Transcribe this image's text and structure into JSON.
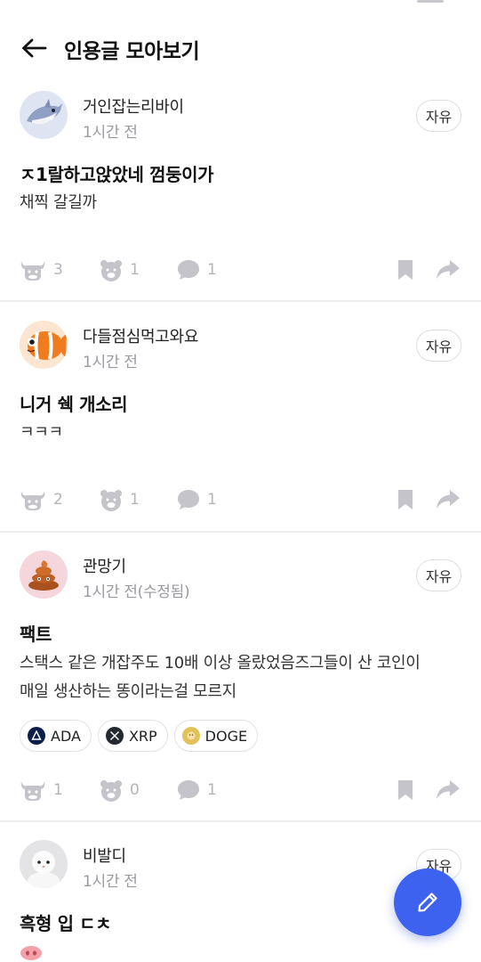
{
  "header": {
    "title": "인용글 모아보기"
  },
  "posts": [
    {
      "author": "거인잡는리바이",
      "time": "1시간 전",
      "category": "자유",
      "title": "ㅈ1랄하고앉았네 껌둥이가",
      "body": "채찍 갈길까",
      "bull": "3",
      "bear": "1",
      "comments": "1"
    },
    {
      "author": "다들점심먹고와요",
      "time": "1시간 전",
      "category": "자유",
      "title": "니거 쉑 개소리",
      "body": "ㅋㅋㅋ",
      "bull": "2",
      "bear": "1",
      "comments": "1"
    },
    {
      "author": "관망기",
      "time": "1시간 전(수정됨)",
      "category": "자유",
      "title": "팩트",
      "body_line1": "스택스 같은 개잡주도 10배 이상 올랐었음즈그들이 산 코인이",
      "body_line2": "매일 생산하는 똥이라는걸 모르지",
      "tags": [
        "ADA",
        "XRP",
        "DOGE"
      ],
      "bull": "1",
      "bear": "0",
      "comments": "1"
    },
    {
      "author": "비발디",
      "time": "1시간 전",
      "category": "자유",
      "title": "흑형 입 ㄷㅊ"
    }
  ],
  "colors": {
    "accent": "#3d62f0",
    "icon_gray": "#c4c4ca",
    "divider": "#eeeef0"
  },
  "icons": [
    "back-arrow-icon",
    "bull-icon",
    "bear-icon",
    "comment-icon",
    "bookmark-icon",
    "share-icon",
    "pencil-icon"
  ]
}
